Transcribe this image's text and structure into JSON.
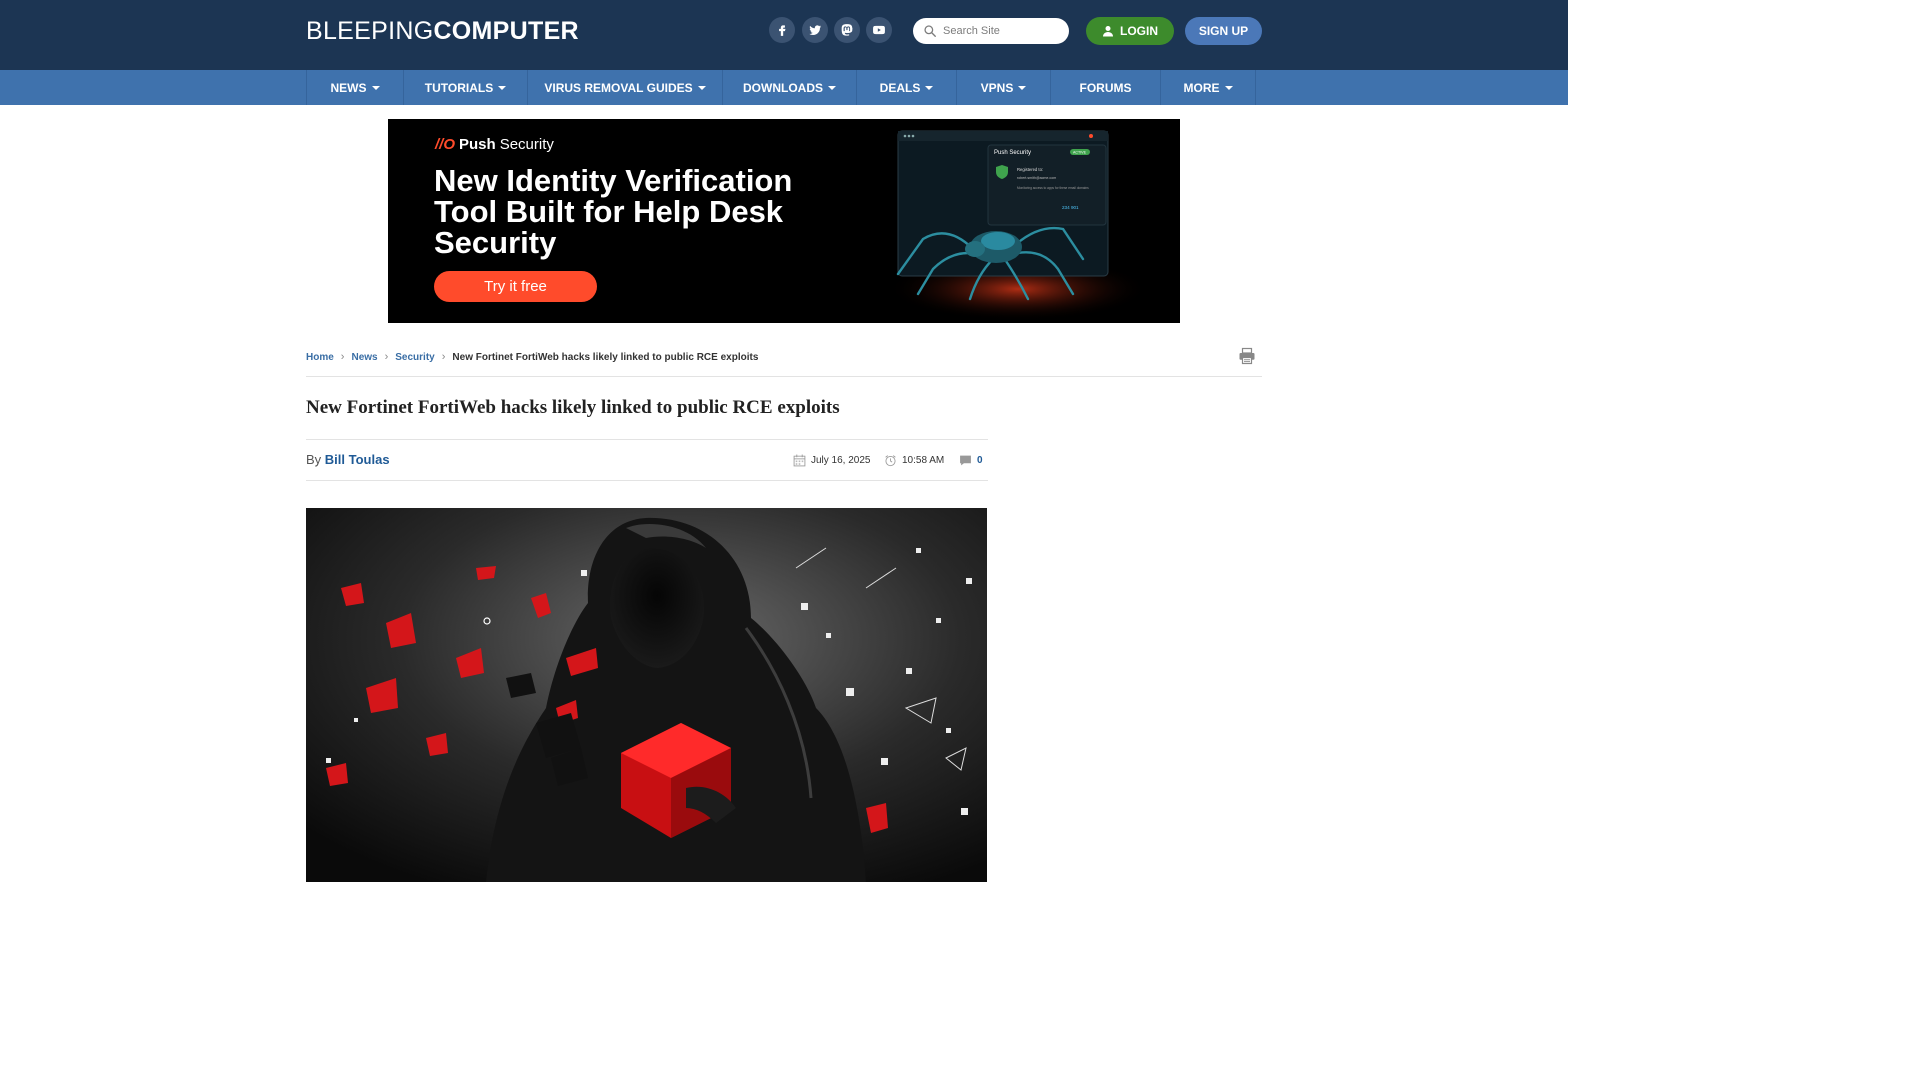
{
  "header": {
    "logo_part1": "BLEEPING",
    "logo_part2": "COMPUTER",
    "social": [
      "facebook-icon",
      "twitter-icon",
      "mastodon-icon",
      "youtube-icon"
    ],
    "search_placeholder": "Search Site",
    "login_label": "LOGIN",
    "signup_label": "SIGN UP"
  },
  "nav": {
    "items": [
      {
        "label": "NEWS",
        "dropdown": true
      },
      {
        "label": "TUTORIALS",
        "dropdown": true
      },
      {
        "label": "VIRUS REMOVAL GUIDES",
        "dropdown": true
      },
      {
        "label": "DOWNLOADS",
        "dropdown": true
      },
      {
        "label": "DEALS",
        "dropdown": true
      },
      {
        "label": "VPNS",
        "dropdown": true
      },
      {
        "label": "FORUMS",
        "dropdown": false
      },
      {
        "label": "MORE",
        "dropdown": true
      }
    ]
  },
  "ad": {
    "brand_mark": "//O",
    "brand_bold": "Push",
    "brand_rest": "Security",
    "headline": "New Identity Verification Tool Built for Help Desk Security",
    "cta": "Try it free",
    "panel": {
      "brand": "Push Security",
      "badge": "ACTIVE",
      "registered_label": "Registered to:",
      "email": "robert.smith@acme.com",
      "monitoring": "Monitoring access to apps for these email domains",
      "count": "234 901"
    }
  },
  "breadcrumb": {
    "items": [
      "Home",
      "News",
      "Security"
    ],
    "current": "New Fortinet FortiWeb hacks likely linked to public RCE exploits"
  },
  "article": {
    "title": "New Fortinet FortiWeb hacks likely linked to public RCE exploits",
    "by_label": "By",
    "author": "Bill Toulas",
    "date": "July 16, 2025",
    "time": "10:58 AM",
    "comments": "0"
  },
  "colors": {
    "header_bg": "#1c3553",
    "nav_bg": "#3f72ad",
    "login_bg": "#3d8b2c",
    "signup_bg": "#4b78b8",
    "ad_accent": "#ff4b2b",
    "link": "#1f5a96"
  }
}
